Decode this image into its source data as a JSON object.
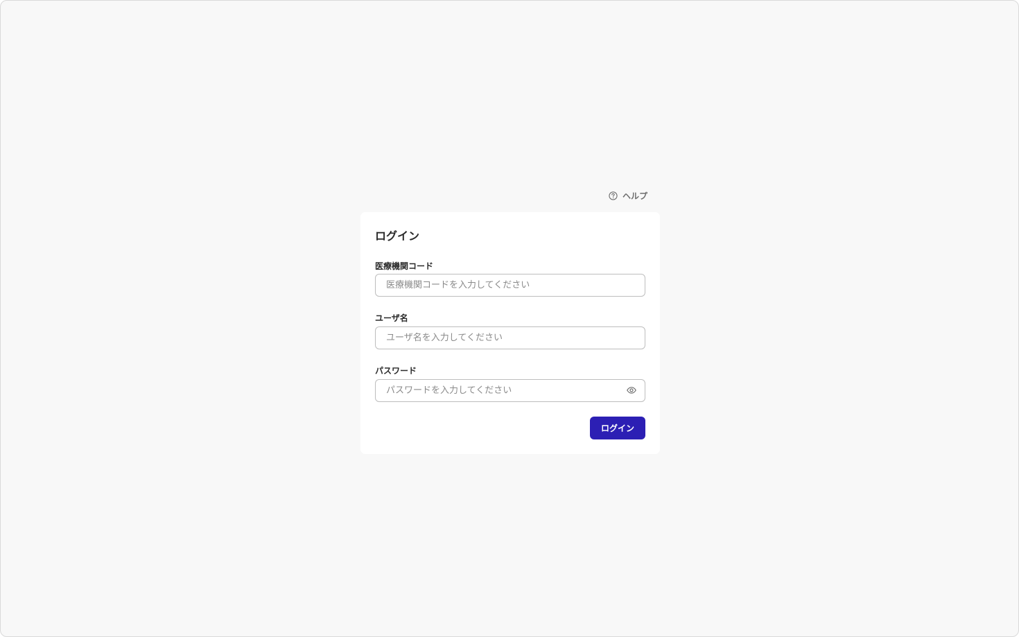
{
  "header": {
    "help_label": "ヘルプ",
    "help_icon": "help-circle-icon"
  },
  "login_form": {
    "title": "ログイン",
    "institution_code": {
      "label": "医療機関コード",
      "value": "",
      "placeholder": "医療機関コードを入力してください"
    },
    "username": {
      "label": "ユーザ名",
      "value": "",
      "placeholder": "ユーザ名を入力してください"
    },
    "password": {
      "label": "パスワード",
      "value": "",
      "placeholder": "パスワードを入力してください",
      "toggle_icon": "eye-icon"
    },
    "submit_label": "ログイン"
  },
  "colors": {
    "background": "#f8f8f8",
    "card": "#ffffff",
    "accent": "#2c1fb4",
    "muted_text": "#6f6f6f",
    "input_border": "#bdbdbd"
  }
}
